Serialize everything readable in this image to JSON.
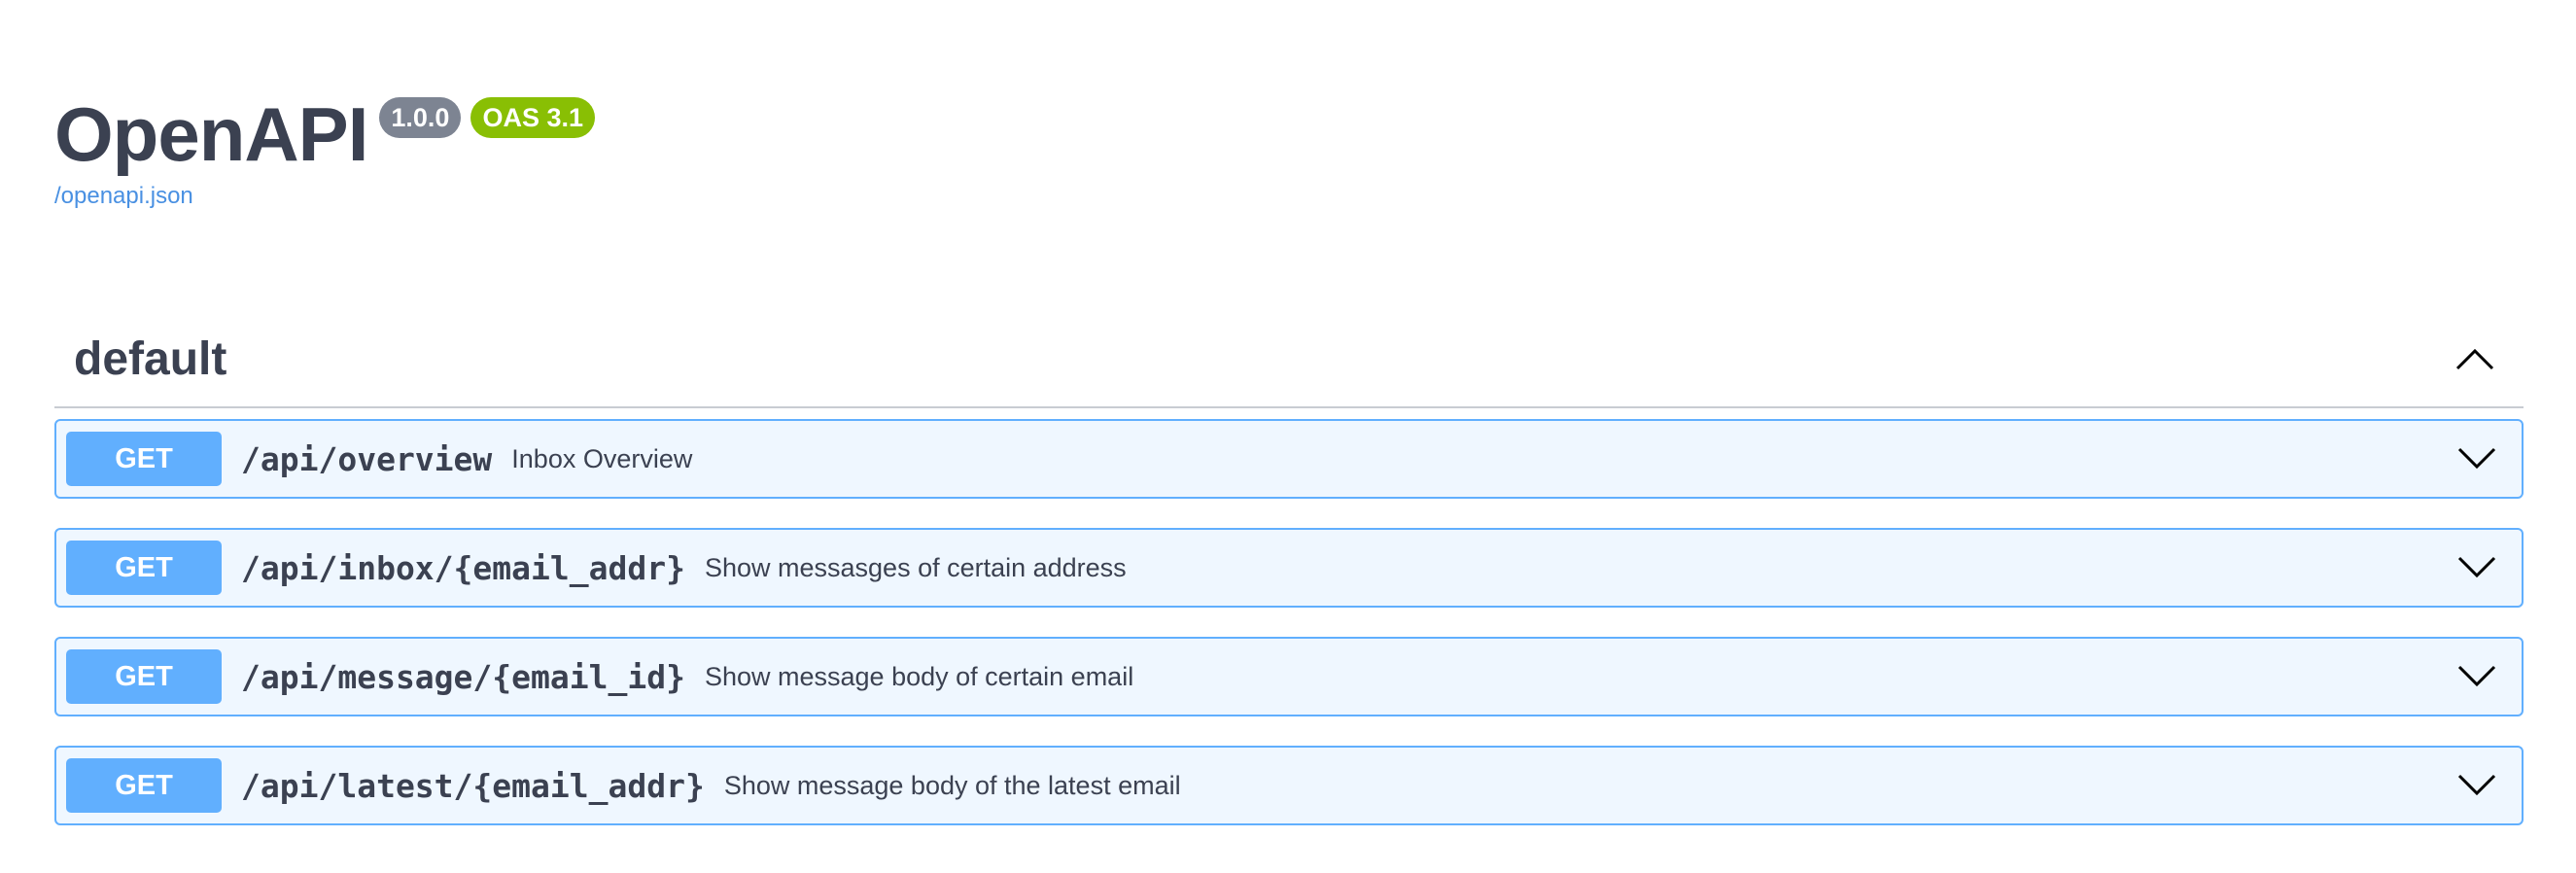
{
  "info": {
    "title": "OpenAPI",
    "version": "1.0.0",
    "oas": "OAS 3.1",
    "spec_link": "/openapi.json"
  },
  "section": {
    "title": "default",
    "expanded": true
  },
  "operations": [
    {
      "method": "GET",
      "path": "/api/overview",
      "summary": "Inbox Overview"
    },
    {
      "method": "GET",
      "path": "/api/inbox/{email_addr}",
      "summary": "Show messasges of certain address"
    },
    {
      "method": "GET",
      "path": "/api/message/{email_id}",
      "summary": "Show message body of certain email"
    },
    {
      "method": "GET",
      "path": "/api/latest/{email_addr}",
      "summary": "Show message body of the latest email"
    }
  ],
  "colors": {
    "get": "#61affe",
    "version_badge": "#7d8492",
    "oas_badge": "#89bf04",
    "link": "#4990e2",
    "text": "#3b4151"
  },
  "icons": {
    "section_toggle": "chevron-up-icon",
    "operation_toggle": "chevron-down-icon"
  }
}
